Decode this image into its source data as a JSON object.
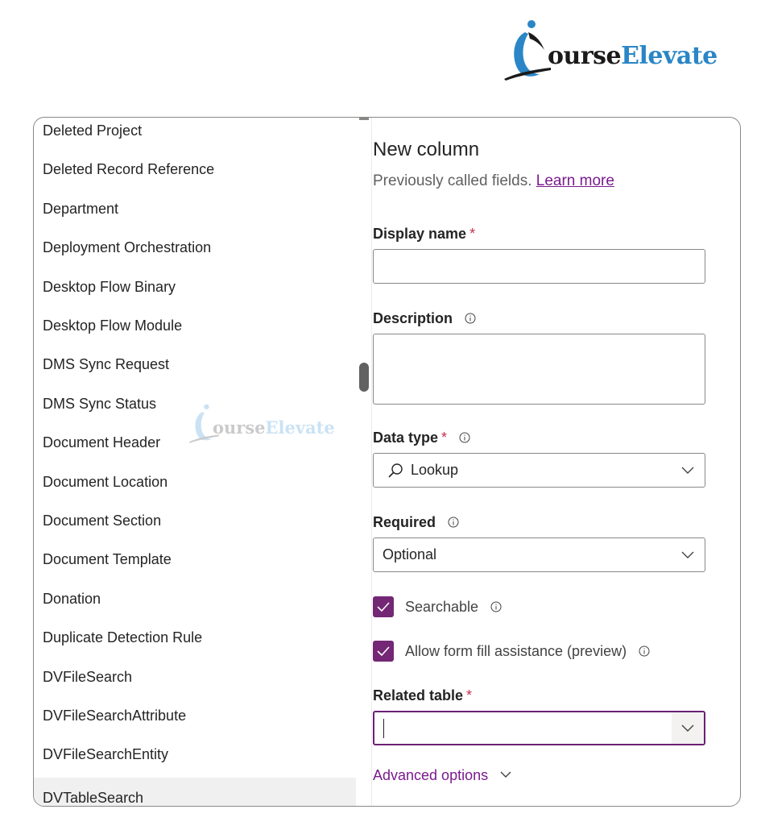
{
  "brand": {
    "logo_text_dark": "ourse",
    "logo_text_accent": "Elevate",
    "watermark_dark": "ourse",
    "watermark_accent": "Elevate"
  },
  "table_list": {
    "items": [
      "Deleted Project",
      "Deleted Record Reference",
      "Department",
      "Deployment Orchestration",
      "Desktop Flow Binary",
      "Desktop Flow Module",
      "DMS Sync Request",
      "DMS Sync Status",
      "Document Header",
      "Document Location",
      "Document Section",
      "Document Template",
      "Donation",
      "Duplicate Detection Rule",
      "DVFileSearch",
      "DVFileSearchAttribute",
      "DVFileSearchEntity",
      "DVTableSearch"
    ],
    "selected": "DVTableSearch"
  },
  "form": {
    "title": "New column",
    "subtitle": "Previously called fields.",
    "learn_more": "Learn more",
    "display_name": {
      "label": "Display name",
      "required": "*",
      "value": ""
    },
    "description": {
      "label": "Description",
      "value": ""
    },
    "data_type": {
      "label": "Data type",
      "required": "*",
      "value": "Lookup"
    },
    "required": {
      "label": "Required",
      "value": "Optional"
    },
    "searchable": {
      "label": "Searchable",
      "checked": true
    },
    "form_fill": {
      "label": "Allow form fill assistance (preview)",
      "checked": true
    },
    "related_table": {
      "label": "Related table",
      "required": "*",
      "value": ""
    },
    "advanced_options": "Advanced options"
  },
  "colors": {
    "accent": "#742774",
    "link": "#7a1a8e",
    "required": "#c4314b",
    "logo_blue": "#2a86c6"
  }
}
